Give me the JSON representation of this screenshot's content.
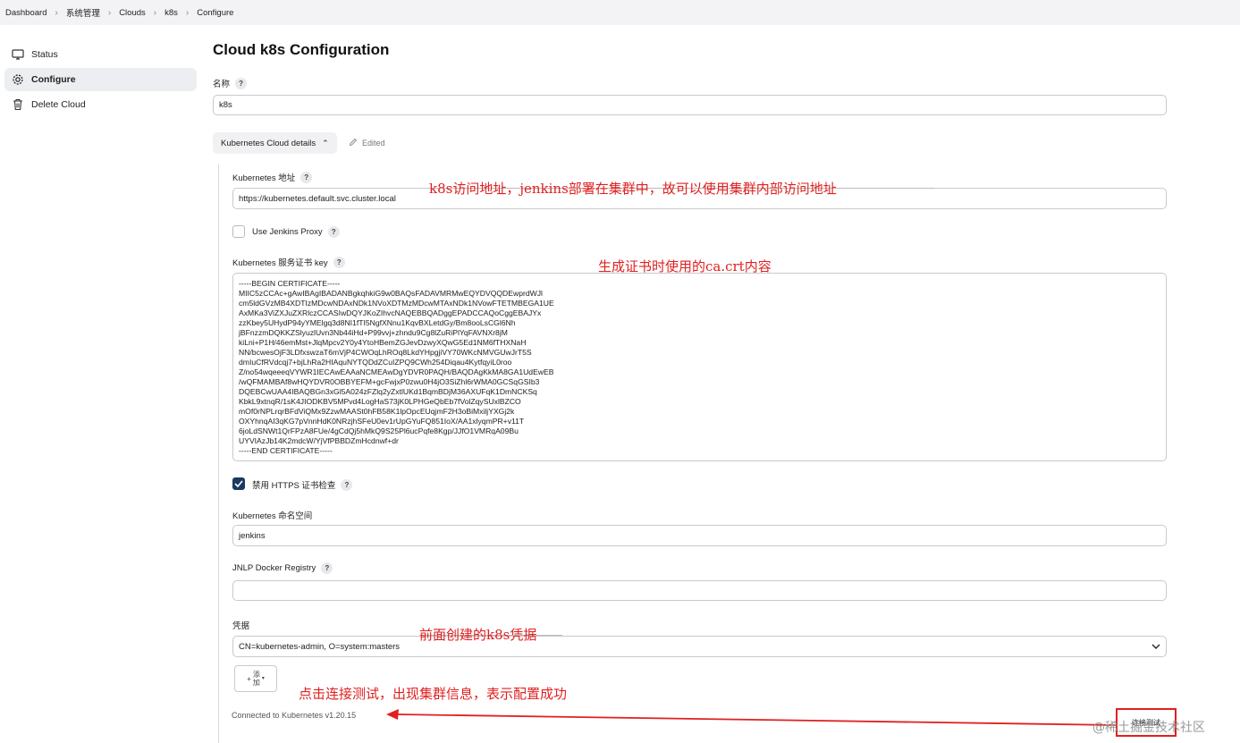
{
  "breadcrumb": [
    "Dashboard",
    "系统管理",
    "Clouds",
    "k8s",
    "Configure"
  ],
  "sidebar": {
    "items": [
      {
        "label": "Status",
        "icon": "monitor-icon"
      },
      {
        "label": "Configure",
        "icon": "gear-icon"
      },
      {
        "label": "Delete Cloud",
        "icon": "trash-icon"
      }
    ]
  },
  "page": {
    "title": "Cloud k8s Configuration"
  },
  "form": {
    "name_label": "名称",
    "name_value": "k8s",
    "details_button": "Kubernetes Cloud details",
    "edited_label": "Edited",
    "url_label": "Kubernetes 地址",
    "url_value": "https://kubernetes.default.svc.cluster.local",
    "proxy_label": "Use Jenkins Proxy",
    "proxy_checked": false,
    "cert_label": "Kubernetes 服务证书 key",
    "cert_value": "-----BEGIN CERTIFICATE-----\nMIIC5zCCAc+gAwIBAgIBADANBgkqhkiG9w0BAQsFADAVMRMwEQYDVQQDEwprdWJl\ncm5ldGVzMB4XDTIzMDcwNDAxNDk1NVoXDTMzMDcwMTAxNDk1NVowFTETMBEGA1UE\nAxMKa3ViZXJuZXRlczCCASIwDQYJKoZIhvcNAQEBBQADggEPADCCAQoCggEBAJYx\nzzKbey5UHydP94yYMElgq3d8NI1fTI5NgfXNnu1KqvBXLetdGy/Bm8ooLsCGl6Nh\njBFnzzmDQKKZSlyuzlUvn3Nb44iHd+P99vvj+zhndu9Cg8lZuRiPlYqFAVNXr8jM\nkiLni+P1H/46emMst+JlqMpcv2Y0y4YtoHBemZGJevDzwyXQwG5Ed1NM6fTHXNaH\nNN/bcwesOjF3LDfxswzaT6mVjP4CWOqLhROq8LkdYHpgjiVY70WKcNMVGUwJrT5S\ndmIuCfRVdcqj7+bjLhRa2HIAquNYTQDdZCuIZPQ9CWh254Diqau4KytfqyiL0roo\nZ/no54wqeeeqVYWR1IECAwEAAaNCMEAwDgYDVR0PAQH/BAQDAgKkMA8GA1UdEwEB\n/wQFMAMBAf8wHQYDVR0OBBYEFM+gcFwjxP0zwu0H4jO3SiZhl6rWMA0GCSqGSIb3\nDQEBCwUAA4IBAQBGn3xGl5A024zFZlq2yZxtlUKd1BqmBDjM36AXUFqK1DmNCKSq\nKbkL9xtnqR/1sK4JIODKBV5MPvd4LogHaS73jK0LPHGeQbEb7fVolZqySUxlBZCO\nmOf0rNPLrqrBFdViQMx9ZzwMAASt0hFB58K1lpOpcEUqjmF2H3oBiMxiljYXGj2k\nOXYhnqAI3qKG7pVnnHdK0NRzjhSFeU0ev1rUpGYuFQ851IoX/AA1xlyqmPR+v11T\n6joLdSNWt1QrFPzA8FUe/4gCdQj5hMkQ9S25Pl6ucPqfe8Kgp/JJfO1VMRqA09Bu\nUYVIAzJb14K2mdcW/YjVfPBBDZmHcdnwf+dr\n-----END CERTIFICATE-----",
    "skip_tls_label": "禁用 HTTPS 证书检查",
    "skip_tls_checked": true,
    "namespace_label": "Kubernetes 命名空间",
    "namespace_value": "jenkins",
    "jnlp_label": "JNLP Docker Registry",
    "jnlp_value": "",
    "credentials_label": "凭据",
    "credentials_value": "CN=kubernetes-admin, O=system:masters",
    "add_button": "添\n加",
    "connected_text": "Connected to Kubernetes v1.20.15",
    "test_button": "连接测试"
  },
  "annotations": {
    "url_note": "k8s访问地址，jenkins部署在集群中，故可以使用集群内部访问地址",
    "cert_note": "生成证书时使用的ca.crt内容",
    "cred_note": "前面创建的k8s凭据",
    "test_note": "点击连接测试，出现集群信息，表示配置成功"
  },
  "watermark": "@稀土掘金技术社区",
  "colors": {
    "annotation": "#e02020",
    "checkbox_checked": "#193a63"
  }
}
